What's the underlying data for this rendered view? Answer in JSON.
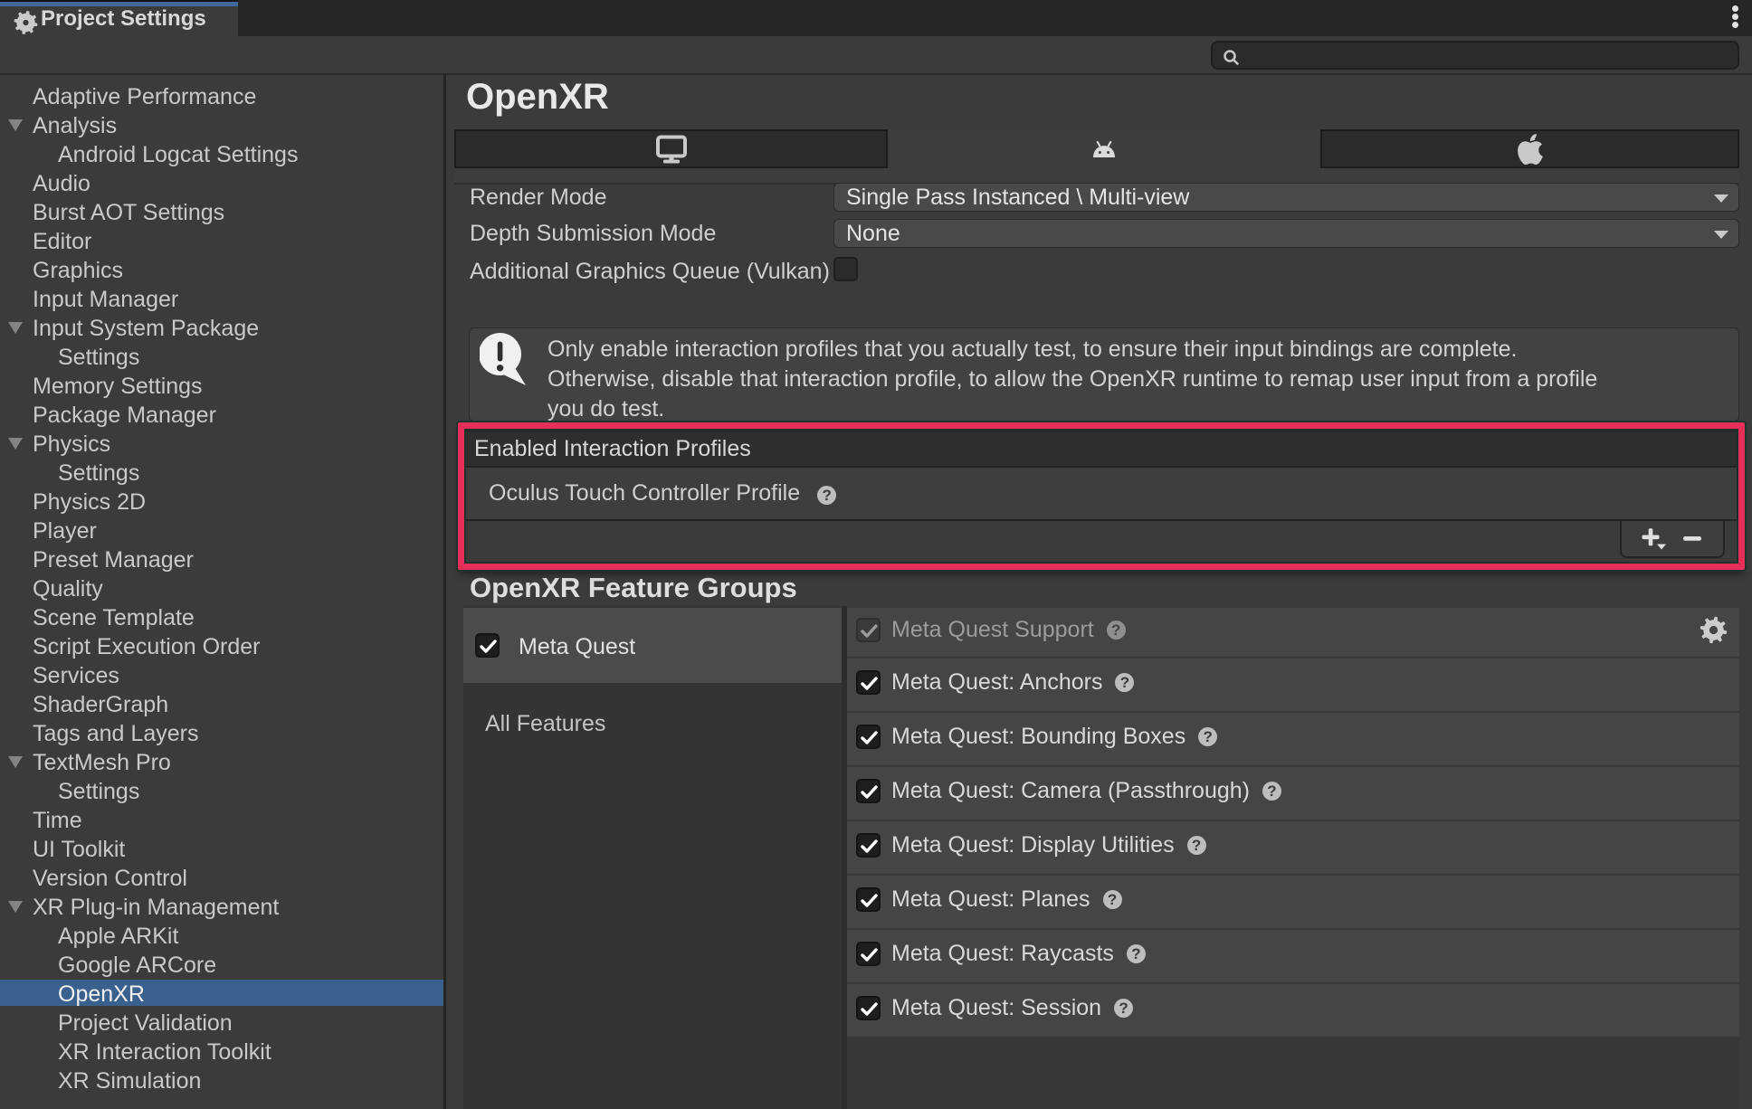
{
  "window": {
    "tab_title": "Project Settings"
  },
  "toolbar": {
    "search_value": ""
  },
  "sidebar": {
    "items": [
      {
        "label": "Adaptive Performance",
        "level": 1
      },
      {
        "label": "Analysis",
        "level": 1,
        "foldout": true
      },
      {
        "label": "Android Logcat Settings",
        "level": 2
      },
      {
        "label": "Audio",
        "level": 1
      },
      {
        "label": "Burst AOT Settings",
        "level": 1
      },
      {
        "label": "Editor",
        "level": 1
      },
      {
        "label": "Graphics",
        "level": 1
      },
      {
        "label": "Input Manager",
        "level": 1
      },
      {
        "label": "Input System Package",
        "level": 1,
        "foldout": true
      },
      {
        "label": "Settings",
        "level": 2
      },
      {
        "label": "Memory Settings",
        "level": 1
      },
      {
        "label": "Package Manager",
        "level": 1
      },
      {
        "label": "Physics",
        "level": 1,
        "foldout": true
      },
      {
        "label": "Settings",
        "level": 2
      },
      {
        "label": "Physics 2D",
        "level": 1
      },
      {
        "label": "Player",
        "level": 1
      },
      {
        "label": "Preset Manager",
        "level": 1
      },
      {
        "label": "Quality",
        "level": 1
      },
      {
        "label": "Scene Template",
        "level": 1
      },
      {
        "label": "Script Execution Order",
        "level": 1
      },
      {
        "label": "Services",
        "level": 1
      },
      {
        "label": "ShaderGraph",
        "level": 1
      },
      {
        "label": "Tags and Layers",
        "level": 1
      },
      {
        "label": "TextMesh Pro",
        "level": 1,
        "foldout": true
      },
      {
        "label": "Settings",
        "level": 2
      },
      {
        "label": "Time",
        "level": 1
      },
      {
        "label": "UI Toolkit",
        "level": 1
      },
      {
        "label": "Version Control",
        "level": 1
      },
      {
        "label": "XR Plug-in Management",
        "level": 1,
        "foldout": true
      },
      {
        "label": "Apple ARKit",
        "level": 2
      },
      {
        "label": "Google ARCore",
        "level": 2
      },
      {
        "label": "OpenXR",
        "level": 2,
        "selected": true
      },
      {
        "label": "Project Validation",
        "level": 2
      },
      {
        "label": "XR Interaction Toolkit",
        "level": 2
      },
      {
        "label": "XR Simulation",
        "level": 2
      }
    ]
  },
  "glyphs": {
    "help": "?"
  },
  "colors": {
    "selection_blue": "#3A608D",
    "tab_accent_blue": "#41699C",
    "annotation_red": "#E62E59"
  },
  "main": {
    "title": "OpenXR",
    "platform_tabs": [
      {
        "icon": "monitor-icon",
        "selected": false
      },
      {
        "icon": "android-icon",
        "selected": true
      },
      {
        "icon": "apple-icon",
        "selected": false
      }
    ],
    "fields": {
      "render_mode": {
        "label": "Render Mode",
        "value": "Single Pass Instanced \\ Multi-view"
      },
      "depth_mode": {
        "label": "Depth Submission Mode",
        "value": "None"
      },
      "vulkan_queue": {
        "label": "Additional Graphics Queue (Vulkan)",
        "checked": false
      }
    },
    "warning": {
      "text": "Only enable interaction profiles that you actually test, to ensure their input bindings are complete. Otherwise, disable that interaction profile, to allow the OpenXR runtime to remap user input from a profile you do test."
    },
    "interaction_profiles": {
      "header": "Enabled Interaction Profiles",
      "items": [
        {
          "label": "Oculus Touch Controller Profile"
        }
      ],
      "add_label": "+",
      "remove_label": "−"
    },
    "feature_groups": {
      "heading": "OpenXR Feature Groups",
      "groups": [
        {
          "label": "Meta Quest",
          "checked": true,
          "selected": true
        }
      ],
      "all_features_label": "All Features",
      "features": [
        {
          "label": "Meta Quest Support",
          "checked": true,
          "disabled": true,
          "has_settings": true
        },
        {
          "label": "Meta Quest: Anchors",
          "checked": true
        },
        {
          "label": "Meta Quest: Bounding Boxes",
          "checked": true
        },
        {
          "label": "Meta Quest: Camera (Passthrough)",
          "checked": true
        },
        {
          "label": "Meta Quest: Display Utilities",
          "checked": true
        },
        {
          "label": "Meta Quest: Planes",
          "checked": true
        },
        {
          "label": "Meta Quest: Raycasts",
          "checked": true
        },
        {
          "label": "Meta Quest: Session",
          "checked": true
        }
      ]
    },
    "annotation_color": "#E62E59"
  }
}
